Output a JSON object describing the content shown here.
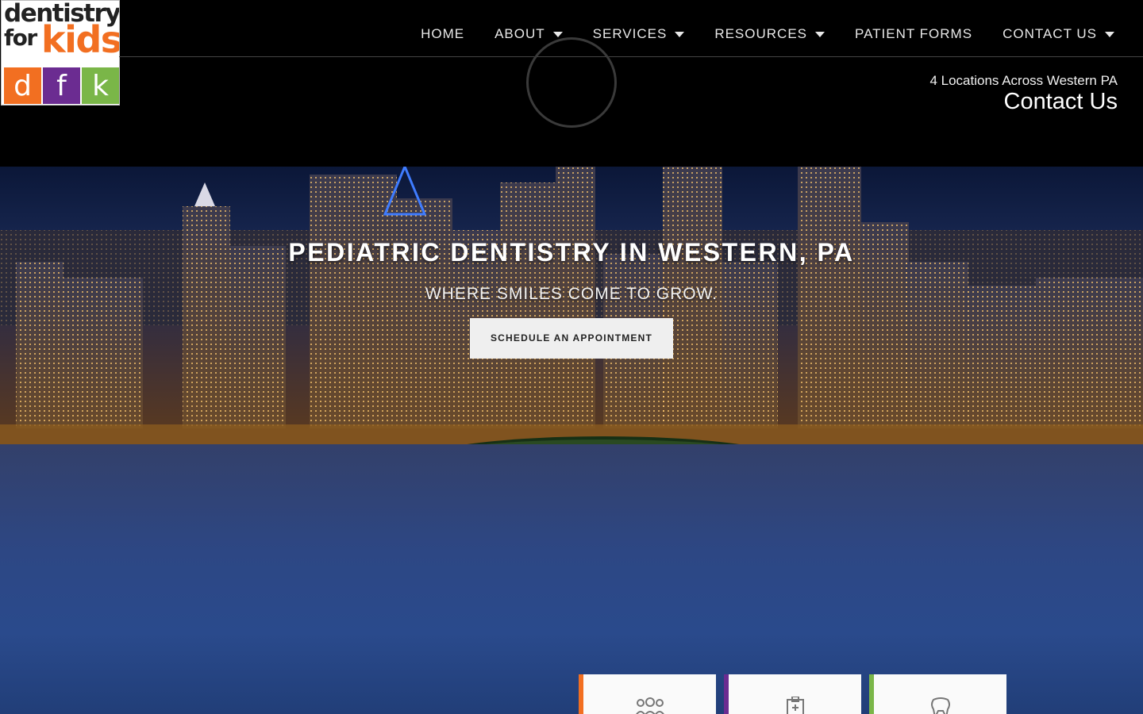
{
  "logo": {
    "line1": "dentistry",
    "line2": "for",
    "line3": "kids",
    "blocks": [
      {
        "letter": "d",
        "color": "#f26f21"
      },
      {
        "letter": "f",
        "color": "#6b2c91"
      },
      {
        "letter": "k",
        "color": "#7ab648"
      }
    ],
    "kids_color": "#f26f21"
  },
  "nav": {
    "items": [
      {
        "label": "HOME",
        "dropdown": false
      },
      {
        "label": "ABOUT",
        "dropdown": true
      },
      {
        "label": "SERVICES",
        "dropdown": true
      },
      {
        "label": "RESOURCES",
        "dropdown": true
      },
      {
        "label": "PATIENT FORMS",
        "dropdown": false
      },
      {
        "label": "CONTACT US",
        "dropdown": true
      }
    ]
  },
  "header": {
    "locations": "4 Locations Across Western PA",
    "contact": "Contact Us"
  },
  "hero": {
    "title": "PEDIATRIC DENTISTRY IN WESTERN, PA",
    "subtitle": "WHERE SMILES COME TO GROW.",
    "cta": "SCHEDULE AN APPOINTMENT"
  },
  "cards": [
    {
      "icon": "people-icon",
      "accent": "#f26f21"
    },
    {
      "icon": "clipboard-icon",
      "accent": "#6b2c91"
    },
    {
      "icon": "tooth-icon",
      "accent": "#7ab648"
    }
  ]
}
